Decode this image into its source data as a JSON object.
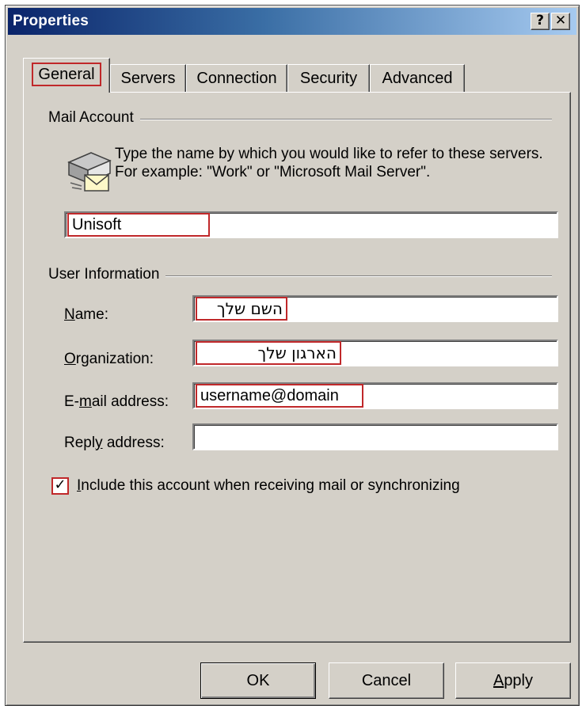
{
  "window": {
    "title": "Properties",
    "help_glyph": "?",
    "close_glyph": "✕"
  },
  "tabs": [
    {
      "label": "General"
    },
    {
      "label": "Servers"
    },
    {
      "label": "Connection"
    },
    {
      "label": "Security"
    },
    {
      "label": "Advanced"
    }
  ],
  "mail_account": {
    "group_label": "Mail Account",
    "icon": "mail-server-icon",
    "description": "Type the name by which you would like to refer to these servers.  For example: \"Work\" or \"Microsoft Mail Server\".",
    "account_name": "Unisoft"
  },
  "user_information": {
    "group_label": "User Information",
    "name_label_mnemonic": "N",
    "name_label_rest": "ame:",
    "name_value": "השם שלך",
    "org_label_mnemonic": "O",
    "org_label_rest": "rganization:",
    "org_value": "הארגון שלך",
    "email_label_pre": "E-",
    "email_label_mnemonic": "m",
    "email_label_rest": "ail address:",
    "email_value": "username@domain",
    "reply_label_pre": "Repl",
    "reply_label_mnemonic": "y",
    "reply_label_rest": " address:",
    "reply_value": ""
  },
  "include_account": {
    "checked": true,
    "check_glyph": "✓",
    "label_mnemonic": "I",
    "label_rest": "nclude this account when receiving mail or synchronizing"
  },
  "buttons": {
    "ok": "OK",
    "cancel": "Cancel",
    "apply_mnemonic": "A",
    "apply_rest": "pply"
  },
  "colors": {
    "titlebar_start": "#0a246a",
    "titlebar_end": "#a6caf0",
    "dialog_face": "#d4d0c8",
    "highlight_box": "#c0282a"
  }
}
